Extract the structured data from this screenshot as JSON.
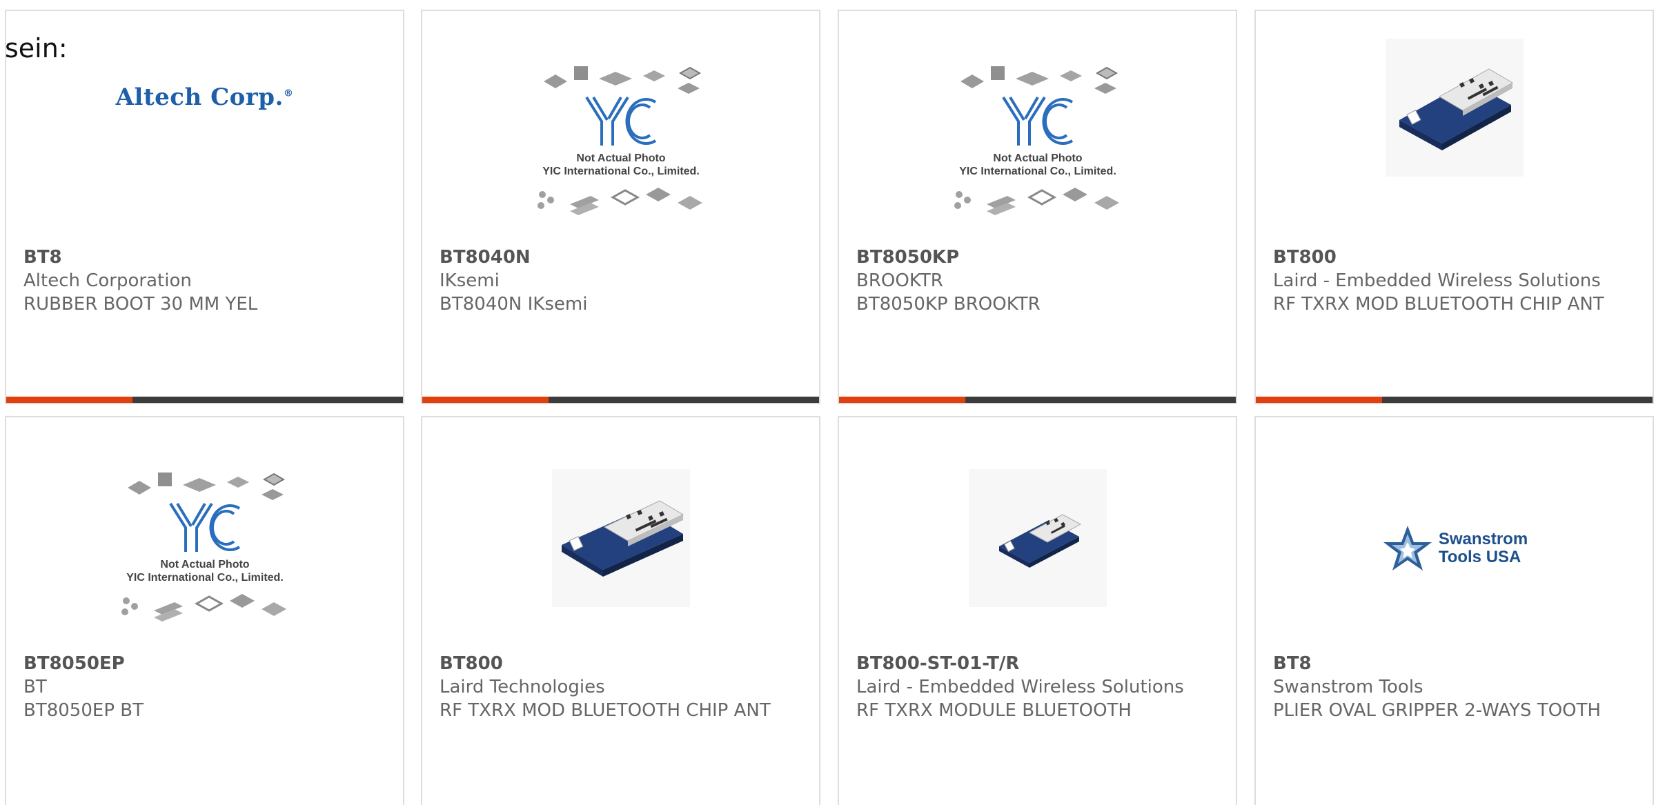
{
  "intro_text": "sein:",
  "accent_color": "#e2400f",
  "bar_color": "#3c3c3c",
  "logo_texts": {
    "altech": "Altech Corp.",
    "yic_line1": "Not Actual Photo",
    "yic_line2": "YIC International Co., Limited.",
    "swanstrom_line1": "Swanstrom",
    "swanstrom_line2": "Tools USA"
  },
  "products": [
    {
      "part_number": "BT8",
      "manufacturer": "Altech Corporation",
      "description": "RUBBER BOOT 30 MM YEL",
      "image": "altech-logo"
    },
    {
      "part_number": "BT8040N",
      "manufacturer": "IKsemi",
      "description": "BT8040N IKsemi",
      "image": "yic-placeholder"
    },
    {
      "part_number": "BT8050KP",
      "manufacturer": "BROOKTR",
      "description": "BT8050KP BROOKTR",
      "image": "yic-placeholder"
    },
    {
      "part_number": "BT800",
      "manufacturer": "Laird - Embedded Wireless Solutions",
      "description": "RF TXRX MOD BLUETOOTH CHIP ANT",
      "image": "bluetooth-module-photo"
    },
    {
      "part_number": "BT8050EP",
      "manufacturer": "BT",
      "description": "BT8050EP BT",
      "image": "yic-placeholder"
    },
    {
      "part_number": "BT800",
      "manufacturer": "Laird Technologies",
      "description": "RF TXRX MOD BLUETOOTH CHIP ANT",
      "image": "bluetooth-module-photo"
    },
    {
      "part_number": "BT800-ST-01-T/R",
      "manufacturer": "Laird - Embedded Wireless Solutions",
      "description": "RF TXRX MODULE BLUETOOTH",
      "image": "bluetooth-module-photo"
    },
    {
      "part_number": "BT8",
      "manufacturer": "Swanstrom Tools",
      "description": "PLIER OVAL GRIPPER 2-WAYS TOOTH",
      "image": "swanstrom-logo"
    }
  ]
}
